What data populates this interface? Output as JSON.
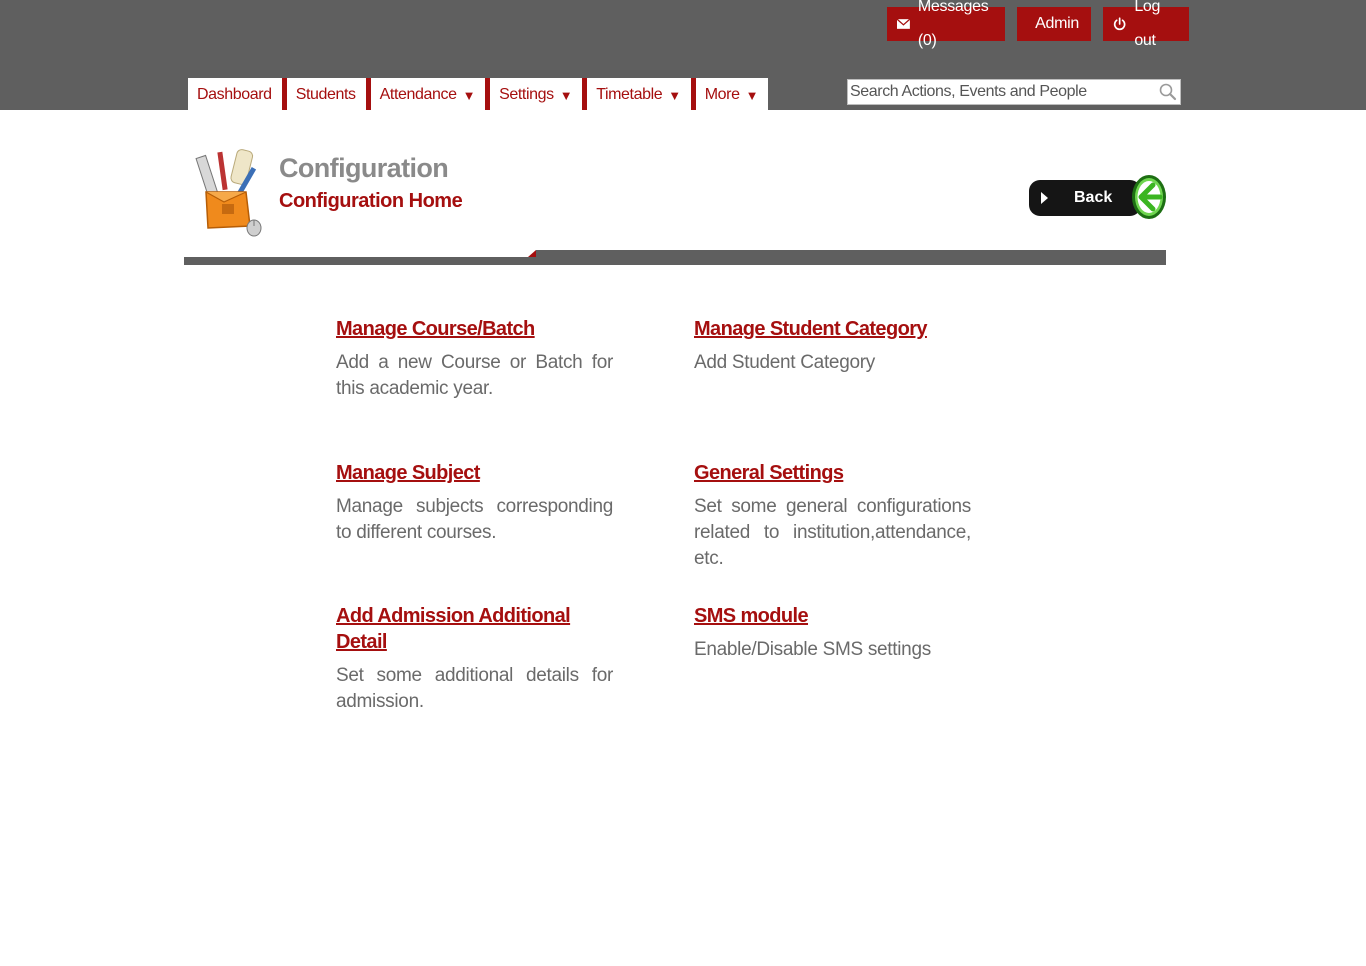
{
  "header": {
    "messages_label": "Messages (0)",
    "admin_label": "Admin",
    "logout_label": "Log out",
    "search_placeholder": "Search Actions, Events and People"
  },
  "nav": {
    "items": [
      {
        "label": "Dashboard",
        "dropdown": false
      },
      {
        "label": "Students",
        "dropdown": false
      },
      {
        "label": "Attendance",
        "dropdown": true
      },
      {
        "label": "Settings",
        "dropdown": true
      },
      {
        "label": "Timetable",
        "dropdown": true
      },
      {
        "label": "More",
        "dropdown": true
      }
    ],
    "dropdown_glyph": "▼"
  },
  "page": {
    "title": "Configuration",
    "subtitle": "Configuration Home",
    "back_label": "Back",
    "icon": "toolbox-icon"
  },
  "config_items": [
    {
      "title": "Manage Course/Batch",
      "description": "Add a new Course or Batch for this academic year."
    },
    {
      "title": "Manage Student Category",
      "description": "Add Student Category"
    },
    {
      "title": "Manage Subject",
      "description": "Manage subjects corresponding to different courses."
    },
    {
      "title": "General Settings",
      "description": "Set some general configurations related to institution,attendance, etc."
    },
    {
      "title": "Add Admission Additional Detail",
      "description": "Set some additional details for admission."
    },
    {
      "title": "SMS module",
      "description": "Enable/Disable SMS settings"
    }
  ],
  "colors": {
    "brand_red": "#a50f0f",
    "header_gray": "#5f5f5f",
    "title_gray": "#8a8a8a",
    "text_gray": "#6a6a6a"
  }
}
